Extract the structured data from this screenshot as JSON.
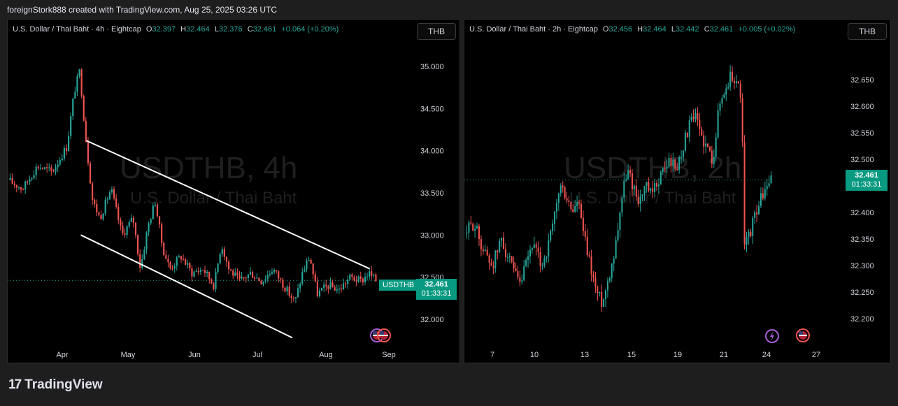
{
  "header": {
    "text": "foreignStork888 created with TradingView.com, Aug 25, 2025 03:26 UTC"
  },
  "left_panel": {
    "legend": {
      "symbol": "U.S. Dollar / Thai Baht · 4h · Eightcap",
      "o_label": "O",
      "o_value": "32.397",
      "h_label": "H",
      "h_value": "32.464",
      "l_label": "L",
      "l_value": "32.376",
      "c_label": "C",
      "c_value": "32.461",
      "change": "+0.064 (+0.20%)"
    },
    "currency_button": "THB",
    "watermark": "USDTHB, 4h",
    "watermark_sub": "U.S. Dollar / Thai Baht",
    "symbol_badge": "USDTHB",
    "price_badge": "32.461",
    "countdown": "01:33:31"
  },
  "right_panel": {
    "legend": {
      "symbol": "U.S. Dollar / Thai Baht · 2h · Eightcap",
      "o_label": "O",
      "o_value": "32.456",
      "h_label": "H",
      "h_value": "32.464",
      "l_label": "L",
      "l_value": "32.442",
      "c_label": "C",
      "c_value": "32.461",
      "change": "+0.005 (+0.02%)"
    },
    "currency_button": "THB",
    "watermark": "USDTHB, 2h",
    "watermark_sub": "U.S. Dollar / Thai Baht",
    "price_badge": "32.461",
    "countdown": "01:33:31"
  },
  "footer": {
    "logo_mark": "17",
    "logo_text": "TradingView"
  },
  "colors": {
    "up": "#26a69a",
    "down": "#ef5350",
    "badge": "#089981",
    "channel": "#ffffff"
  },
  "chart_data": [
    {
      "type": "candlestick",
      "symbol": "USDTHB",
      "interval": "4h",
      "x_tick_labels": [
        "Apr",
        "May",
        "Jun",
        "Jul",
        "Aug",
        "Sep"
      ],
      "y_tick_labels": [
        "35.000",
        "34.500",
        "34.000",
        "33.500",
        "33.000",
        "32.500",
        "32.000"
      ],
      "ylim": [
        31.8,
        35.2
      ],
      "last_price": 32.461,
      "path_anchors": [
        [
          0,
          33.65
        ],
        [
          0.04,
          33.55
        ],
        [
          0.08,
          33.82
        ],
        [
          0.12,
          33.75
        ],
        [
          0.16,
          34.05
        ],
        [
          0.18,
          34.7
        ],
        [
          0.195,
          34.95
        ],
        [
          0.21,
          34.2
        ],
        [
          0.23,
          33.4
        ],
        [
          0.25,
          33.2
        ],
        [
          0.28,
          33.55
        ],
        [
          0.31,
          33.0
        ],
        [
          0.34,
          33.2
        ],
        [
          0.36,
          32.6
        ],
        [
          0.38,
          33.1
        ],
        [
          0.4,
          33.4
        ],
        [
          0.42,
          32.85
        ],
        [
          0.44,
          32.6
        ],
        [
          0.47,
          32.75
        ],
        [
          0.5,
          32.55
        ],
        [
          0.53,
          32.6
        ],
        [
          0.56,
          32.4
        ],
        [
          0.58,
          32.9
        ],
        [
          0.6,
          32.6
        ],
        [
          0.63,
          32.45
        ],
        [
          0.66,
          32.55
        ],
        [
          0.69,
          32.45
        ],
        [
          0.72,
          32.6
        ],
        [
          0.75,
          32.4
        ],
        [
          0.78,
          32.2
        ],
        [
          0.8,
          32.55
        ],
        [
          0.82,
          32.75
        ],
        [
          0.84,
          32.3
        ],
        [
          0.87,
          32.4
        ],
        [
          0.9,
          32.35
        ],
        [
          0.93,
          32.5
        ],
        [
          0.96,
          32.45
        ],
        [
          0.98,
          32.55
        ],
        [
          1.0,
          32.461
        ]
      ],
      "channel_upper": [
        [
          0.21,
          34.12
        ],
        [
          0.98,
          32.6
        ]
      ],
      "channel_lower": [
        [
          0.195,
          33.0
        ],
        [
          0.77,
          31.78
        ]
      ]
    },
    {
      "type": "candlestick",
      "symbol": "USDTHB",
      "interval": "2h",
      "x_tick_labels": [
        "7",
        "10",
        "13",
        "15",
        "19",
        "21",
        "24",
        "27"
      ],
      "y_tick_labels": [
        "32.650",
        "32.600",
        "32.550",
        "32.500",
        "32.450",
        "32.400",
        "32.350",
        "32.300",
        "32.250",
        "32.200"
      ],
      "ylim": [
        32.18,
        32.68
      ],
      "last_price": 32.461,
      "path_anchors": [
        [
          0,
          32.36
        ],
        [
          0.03,
          32.38
        ],
        [
          0.06,
          32.33
        ],
        [
          0.09,
          32.3
        ],
        [
          0.12,
          32.35
        ],
        [
          0.15,
          32.3
        ],
        [
          0.18,
          32.26
        ],
        [
          0.2,
          32.3
        ],
        [
          0.22,
          32.34
        ],
        [
          0.25,
          32.3
        ],
        [
          0.27,
          32.33
        ],
        [
          0.29,
          32.38
        ],
        [
          0.31,
          32.45
        ],
        [
          0.33,
          32.43
        ],
        [
          0.35,
          32.4
        ],
        [
          0.37,
          32.42
        ],
        [
          0.39,
          32.35
        ],
        [
          0.41,
          32.3
        ],
        [
          0.43,
          32.25
        ],
        [
          0.45,
          32.23
        ],
        [
          0.47,
          32.28
        ],
        [
          0.49,
          32.33
        ],
        [
          0.51,
          32.42
        ],
        [
          0.53,
          32.48
        ],
        [
          0.55,
          32.45
        ],
        [
          0.57,
          32.42
        ],
        [
          0.59,
          32.45
        ],
        [
          0.61,
          32.43
        ],
        [
          0.63,
          32.46
        ],
        [
          0.65,
          32.48
        ],
        [
          0.67,
          32.5
        ],
        [
          0.69,
          32.48
        ],
        [
          0.71,
          32.52
        ],
        [
          0.73,
          32.56
        ],
        [
          0.75,
          32.58
        ],
        [
          0.77,
          32.55
        ],
        [
          0.79,
          32.52
        ],
        [
          0.81,
          32.5
        ],
        [
          0.83,
          32.6
        ],
        [
          0.85,
          32.63
        ],
        [
          0.87,
          32.66
        ],
        [
          0.89,
          32.64
        ],
        [
          0.905,
          32.62
        ],
        [
          0.91,
          32.33
        ],
        [
          0.93,
          32.36
        ],
        [
          0.95,
          32.4
        ],
        [
          0.97,
          32.43
        ],
        [
          1.0,
          32.461
        ]
      ]
    }
  ]
}
